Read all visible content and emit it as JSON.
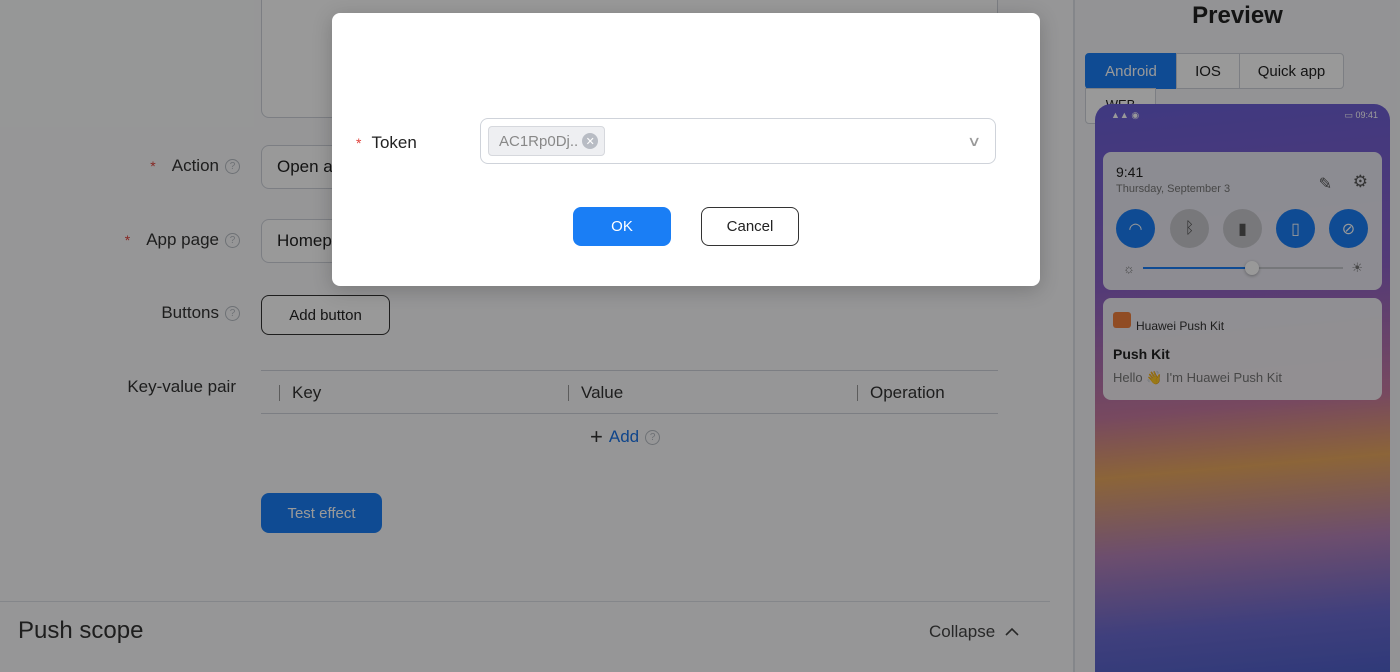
{
  "form": {
    "action": {
      "label": "Action",
      "value": "Open a"
    },
    "app_page": {
      "label": "App page",
      "value": "Homep"
    },
    "buttons": {
      "label": "Buttons",
      "add_button": "Add button"
    },
    "kv": {
      "label": "Key-value pair",
      "columns": [
        "Key",
        "Value",
        "Operation"
      ],
      "add": "Add"
    },
    "test_effect": "Test effect",
    "help_glyph": "?"
  },
  "push_scope": {
    "title": "Push scope",
    "collapse": "Collapse"
  },
  "preview": {
    "title": "Preview",
    "tabs": [
      "Android",
      "IOS",
      "Quick app",
      "WEB"
    ],
    "active_tab": "Android",
    "status_time": "09:41",
    "qs": {
      "time": "9:41",
      "date": "Thursday, September 3"
    },
    "notification": {
      "app": "Huawei Push Kit",
      "title": "Push Kit",
      "body": "Hello 👋 I'm Huawei Push Kit"
    }
  },
  "modal": {
    "token_label": "Token",
    "token_value": "AC1Rp0Dj..",
    "ok": "OK",
    "cancel": "Cancel"
  },
  "colors": {
    "primary": "#1a7ef5",
    "required": "#e0413b"
  }
}
